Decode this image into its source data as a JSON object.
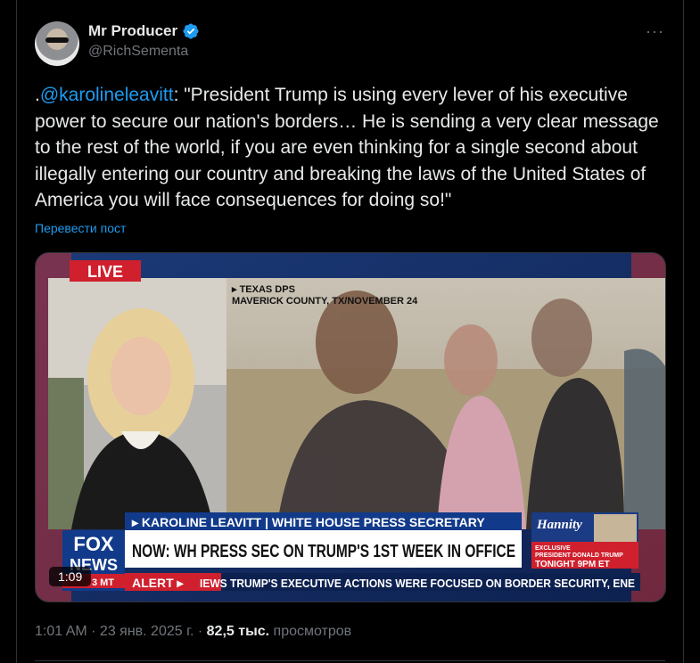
{
  "author": {
    "display_name": "Mr Producer",
    "handle": "@RichSementa",
    "verified": true
  },
  "menu": {
    "more_icon": "more-dots-icon",
    "more_label": "···"
  },
  "tweet": {
    "prefix": ".",
    "mention": "@karolineleavitt",
    "text": ": \"President Trump is using every lever of his executive power to secure our nation's borders… He is sending a very clear message to the rest of the world, if you are even thinking for a single second about illegally entering our country and breaking the laws of the United States of America you will face consequences for doing so!\""
  },
  "translate_label": "Перевести пост",
  "video": {
    "live_label": "LIVE",
    "location_line1": "▸ TEXAS DPS",
    "location_line2": "MAVERICK COUNTY, TX/NOVEMBER 24",
    "name_bar": "▸ KAROLINE LEAVITT | WHITE HOUSE PRESS SECRETARY",
    "headline": "NOW: WH PRESS SEC ON TRUMP'S 1ST WEEK IN OFFICE",
    "alert_label": "ALERT ▸",
    "ticker": "IEWS  TRUMP'S EXECUTIVE ACTIONS WERE FOCUSED ON BORDER SECURITY, ENE",
    "fox_line1": "FOX",
    "fox_line2": "NEWS",
    "timezone": "3 MT",
    "promo_show": "Hannity",
    "promo_line1": "EXCLUSIVE",
    "promo_line2": "PRESIDENT DONALD TRUMP",
    "promo_line3": "TONIGHT 9PM ET",
    "duration": "1:09"
  },
  "meta": {
    "time": "1:01 AM",
    "sep1": " · ",
    "date": "23 янв. 2025 г.",
    "sep2": " · ",
    "views": "82,5 тыс.",
    "views_label": " просмотров"
  },
  "colors": {
    "accent": "#1d9bf0",
    "text": "#e7e9ea",
    "muted": "#71767b",
    "background": "#000000",
    "fox_red": "#d0202e",
    "fox_blue": "#123a8a"
  }
}
